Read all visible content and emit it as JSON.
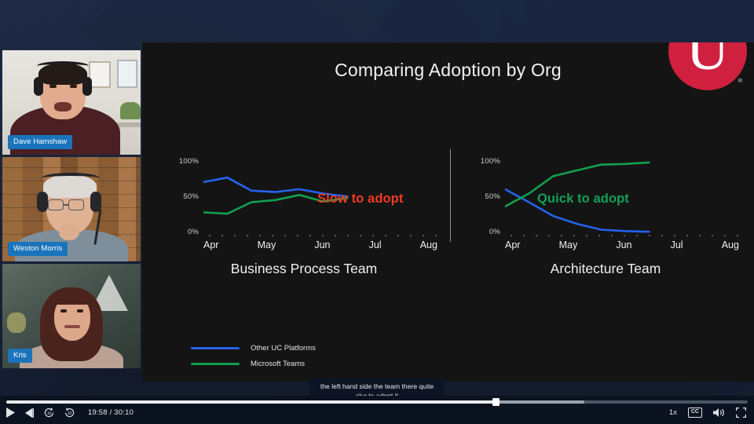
{
  "slide": {
    "title": "Comparing Adoption by Org",
    "logo": {
      "letter": "U",
      "registered": "®",
      "color": "#cf2040"
    },
    "divider": true,
    "callouts": {
      "left": {
        "text": "Slow to adopt",
        "color": "#ef3b24"
      },
      "right": {
        "text": "Quick to adopt",
        "color": "#13a155"
      }
    },
    "legend": [
      {
        "label": "Other UC Platforms",
        "color": "#2563eb"
      },
      {
        "label": "Microsoft Teams",
        "color": "#12a04e"
      }
    ]
  },
  "chart_data": [
    {
      "type": "line",
      "title": "Business Process Team",
      "xlabel": "",
      "ylabel": "",
      "ylim": [
        0,
        100
      ],
      "ytick_labels": [
        "100%",
        "50%",
        "0%"
      ],
      "ytick_values": [
        100,
        50,
        0
      ],
      "categories": [
        "Apr",
        "May",
        "Jun",
        "Jul",
        "Aug"
      ],
      "grid": false,
      "legend_position": "bottom-left",
      "annotation": "Slow to adopt",
      "x": [
        0,
        0.18,
        0.36,
        0.54,
        0.72,
        0.9,
        1.08
      ],
      "series": [
        {
          "name": "Other UC Platforms",
          "color": "#2563eb",
          "values": [
            72,
            78,
            60,
            58,
            62,
            56,
            52
          ]
        },
        {
          "name": "Microsoft Teams",
          "color": "#12a04e",
          "values": [
            30,
            28,
            44,
            47,
            54,
            45,
            50
          ]
        }
      ]
    },
    {
      "type": "line",
      "title": "Architecture Team",
      "xlabel": "",
      "ylabel": "",
      "ylim": [
        0,
        100
      ],
      "ytick_labels": [
        "100%",
        "50%",
        "0%"
      ],
      "ytick_values": [
        100,
        50,
        0
      ],
      "categories": [
        "Apr",
        "May",
        "Jun",
        "Jul",
        "Aug"
      ],
      "grid": false,
      "legend_position": "bottom-left",
      "annotation": "Quick to adopt",
      "x": [
        0,
        0.18,
        0.36,
        0.54,
        0.72,
        0.9,
        1.08
      ],
      "series": [
        {
          "name": "Other UC Platforms",
          "color": "#2563eb",
          "values": [
            62,
            44,
            25,
            14,
            6,
            4,
            3
          ]
        },
        {
          "name": "Microsoft Teams",
          "color": "#12a04e",
          "values": [
            38,
            56,
            80,
            88,
            96,
            97,
            99
          ]
        }
      ]
    }
  ],
  "participants": [
    {
      "name": "Dave Hamshaw"
    },
    {
      "name": "Weston Morris"
    },
    {
      "name": "Kris"
    }
  ],
  "caption": {
    "line1": "the left hand side the team there quite",
    "line2": "slur to adopt it"
  },
  "player": {
    "time_display": "19:58 / 30:10",
    "current_time": "19:58",
    "duration": "30:10",
    "progress_percent": 66,
    "speed": "1x",
    "cc_label": "CC",
    "icons": {
      "play": "play-icon",
      "next": "next-track-icon",
      "rewind": "rewind-10-icon",
      "forward": "forward-10-icon",
      "captions": "closed-captions-icon",
      "volume": "volume-icon",
      "fullscreen": "fullscreen-icon"
    }
  }
}
